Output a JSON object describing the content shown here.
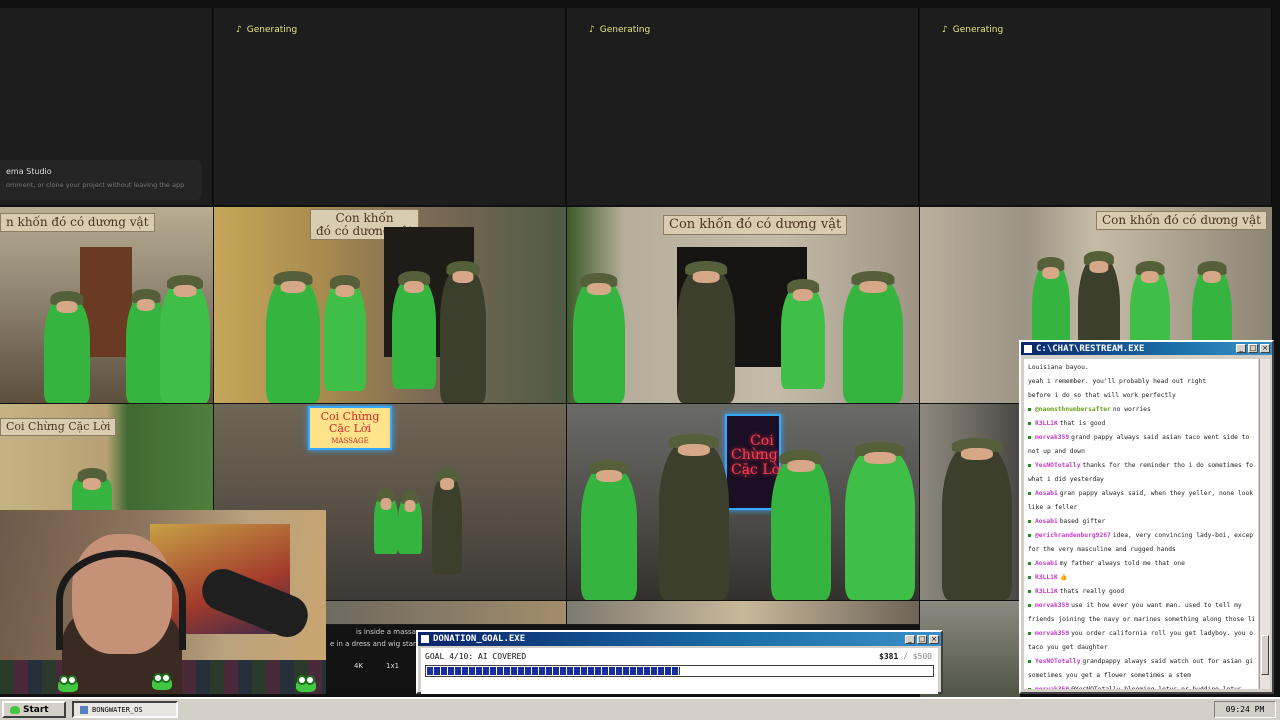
{
  "generation": {
    "columns": [
      {
        "status": "Generating"
      },
      {
        "status": "Generating"
      },
      {
        "status": "Generating"
      }
    ],
    "studio_card": {
      "title": "ema Studio",
      "subtitle": "omment, or clone your project without leaving the app"
    },
    "tile_signs": {
      "sign_a": "n khốn đó có dương vật",
      "sign_b": "Con khốn\nđó có dương vật",
      "sign_c": "Con khốn đó có dương vật",
      "sign_d": "Con khốn đó có dương vật",
      "sign_e": "Coi Chừng Cặc Lời",
      "neon_1": "Coi Chừng Cặc Lời",
      "neon_1_sub": "MASSAGE",
      "neon_2": "Coi\nChừng\nCặc Lời"
    }
  },
  "prompt_strip": {
    "line_1": "is inside a massag",
    "line_2": "e in a dress and wig stanc",
    "chip_res": "4K",
    "chip_ratio": "1x1"
  },
  "donation": {
    "title": "DONATION_GOAL.EXE",
    "goal_label": "GOAL 4/10: AI COVERED",
    "amount": "$381",
    "total": "/ $500",
    "progress": 0.5,
    "window_buttons": [
      "_",
      "□",
      "×"
    ]
  },
  "chat": {
    "title": "C:\\CHAT\\RESTREAM.EXE",
    "window_buttons": [
      "_",
      "□",
      "×"
    ],
    "messages": [
      {
        "user": "",
        "text": "Louisiana bayou.",
        "color": "#222"
      },
      {
        "user": "",
        "text": "yeah i remember. you'll probably head out right",
        "color": "#222"
      },
      {
        "user": "",
        "text": "before i do so that will work perfectly",
        "color": "#222"
      },
      {
        "user": "@naomsthnumbersafter",
        "text": "no worries",
        "color": "#6b9e1f"
      },
      {
        "user": "R3LL1K",
        "text": "that is good",
        "color": "#c03bc8"
      },
      {
        "user": "morvak359",
        "text": "grand pappy always said asian taco went side to side",
        "color": "#c03bc8"
      },
      {
        "user": "",
        "text": "not up and down",
        "color": "#222"
      },
      {
        "user": "YesNOTotally",
        "text": "thanks for the reminder tho i do sometimes forget",
        "color": "#c03bc8"
      },
      {
        "user": "",
        "text": "what i did yesterday",
        "color": "#222"
      },
      {
        "user": "Aosabi",
        "text": "gran pappy always said, when they yeller, none look",
        "color": "#c03bc8"
      },
      {
        "user": "",
        "text": "like a feller",
        "color": "#222"
      },
      {
        "user": "Aosabi",
        "text": "based gifter",
        "color": "#c03bc8"
      },
      {
        "user": "@erichrandenburg9267",
        "text": "idea, very convincing lady-boi, except",
        "color": "#c03bc8"
      },
      {
        "user": "",
        "text": "for the very masculine and rugged hands",
        "color": "#222"
      },
      {
        "user": "Aosabi",
        "text": "my father always told me that one",
        "color": "#c03bc8"
      },
      {
        "user": "R3LL1K",
        "text": "👍",
        "color": "#c03bc8"
      },
      {
        "user": "R3LL1K",
        "text": "thats really good",
        "color": "#c03bc8"
      },
      {
        "user": "morvak359",
        "text": "use it how ever you want man. used to tell my",
        "color": "#c03bc8"
      },
      {
        "user": "",
        "text": "friends joining the navy or marines something along those lines.",
        "color": "#222"
      },
      {
        "user": "morvak359",
        "text": "you order california roll you get ladyboy. you order",
        "color": "#c03bc8"
      },
      {
        "user": "",
        "text": "taco you get daughter",
        "color": "#222"
      },
      {
        "user": "YesNOTotally",
        "text": "grandpappy always said watch out for asian girls,",
        "color": "#c03bc8"
      },
      {
        "user": "",
        "text": "sometimes you get a flower sometimes a stem",
        "color": "#222"
      },
      {
        "user": "morvak359",
        "text": "@YesNOTotally blooming lotus or budding lotus",
        "color": "#c03bc8"
      }
    ]
  },
  "taskbar": {
    "start_label": "Start",
    "task_label": "BONGWATER_OS",
    "clock": "09:24 PM"
  },
  "icons": {
    "start": "frog-icon",
    "task": "window-icon",
    "gen": "sparkle-icon"
  }
}
